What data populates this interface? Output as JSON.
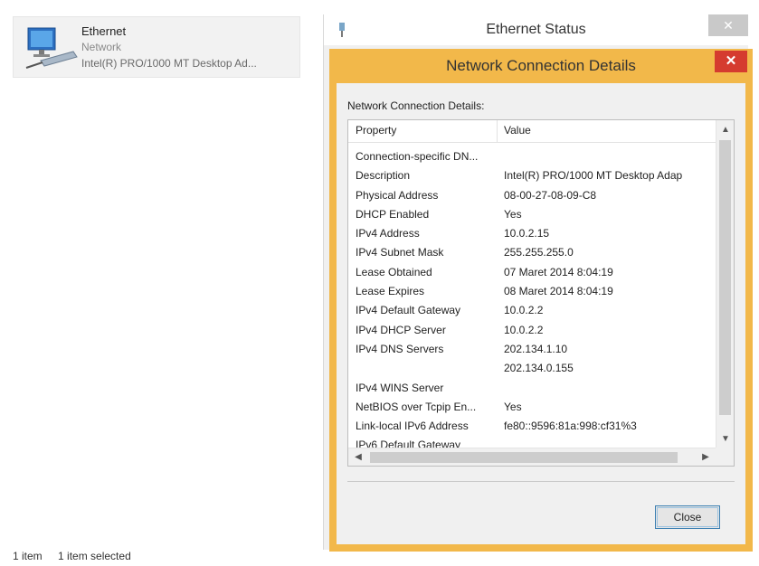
{
  "network_item": {
    "name": "Ethernet",
    "type": "Network",
    "adapter": "Intel(R) PRO/1000 MT Desktop Ad..."
  },
  "statusbar": {
    "count": "1 item",
    "selected": "1 item selected"
  },
  "status_window": {
    "title": "Ethernet Status",
    "close": "✕"
  },
  "dialog": {
    "title": "Network Connection Details",
    "close": "✕",
    "section_label": "Network Connection Details:",
    "columns": {
      "property": "Property",
      "value": "Value"
    },
    "rows": [
      {
        "property": "Connection-specific DN...",
        "value": ""
      },
      {
        "property": "Description",
        "value": "Intel(R) PRO/1000 MT Desktop Adap"
      },
      {
        "property": "Physical Address",
        "value": "08-00-27-08-09-C8"
      },
      {
        "property": "DHCP Enabled",
        "value": "Yes"
      },
      {
        "property": "IPv4 Address",
        "value": "10.0.2.15"
      },
      {
        "property": "IPv4 Subnet Mask",
        "value": "255.255.255.0"
      },
      {
        "property": "Lease Obtained",
        "value": "07 Maret 2014 8:04:19"
      },
      {
        "property": "Lease Expires",
        "value": "08 Maret 2014 8:04:19"
      },
      {
        "property": "IPv4 Default Gateway",
        "value": "10.0.2.2"
      },
      {
        "property": "IPv4 DHCP Server",
        "value": "10.0.2.2"
      },
      {
        "property": "IPv4 DNS Servers",
        "value": "202.134.1.10"
      },
      {
        "property": "",
        "value": "202.134.0.155"
      },
      {
        "property": "IPv4 WINS Server",
        "value": ""
      },
      {
        "property": "NetBIOS over Tcpip En...",
        "value": "Yes"
      },
      {
        "property": "Link-local IPv6 Address",
        "value": "fe80::9596:81a:998:cf31%3"
      },
      {
        "property": "IPv6 Default Gateway",
        "value": ""
      }
    ],
    "close_button": "Close"
  },
  "colors": {
    "dialog_frame": "#f2b84a",
    "close_red": "#d53b2f"
  }
}
